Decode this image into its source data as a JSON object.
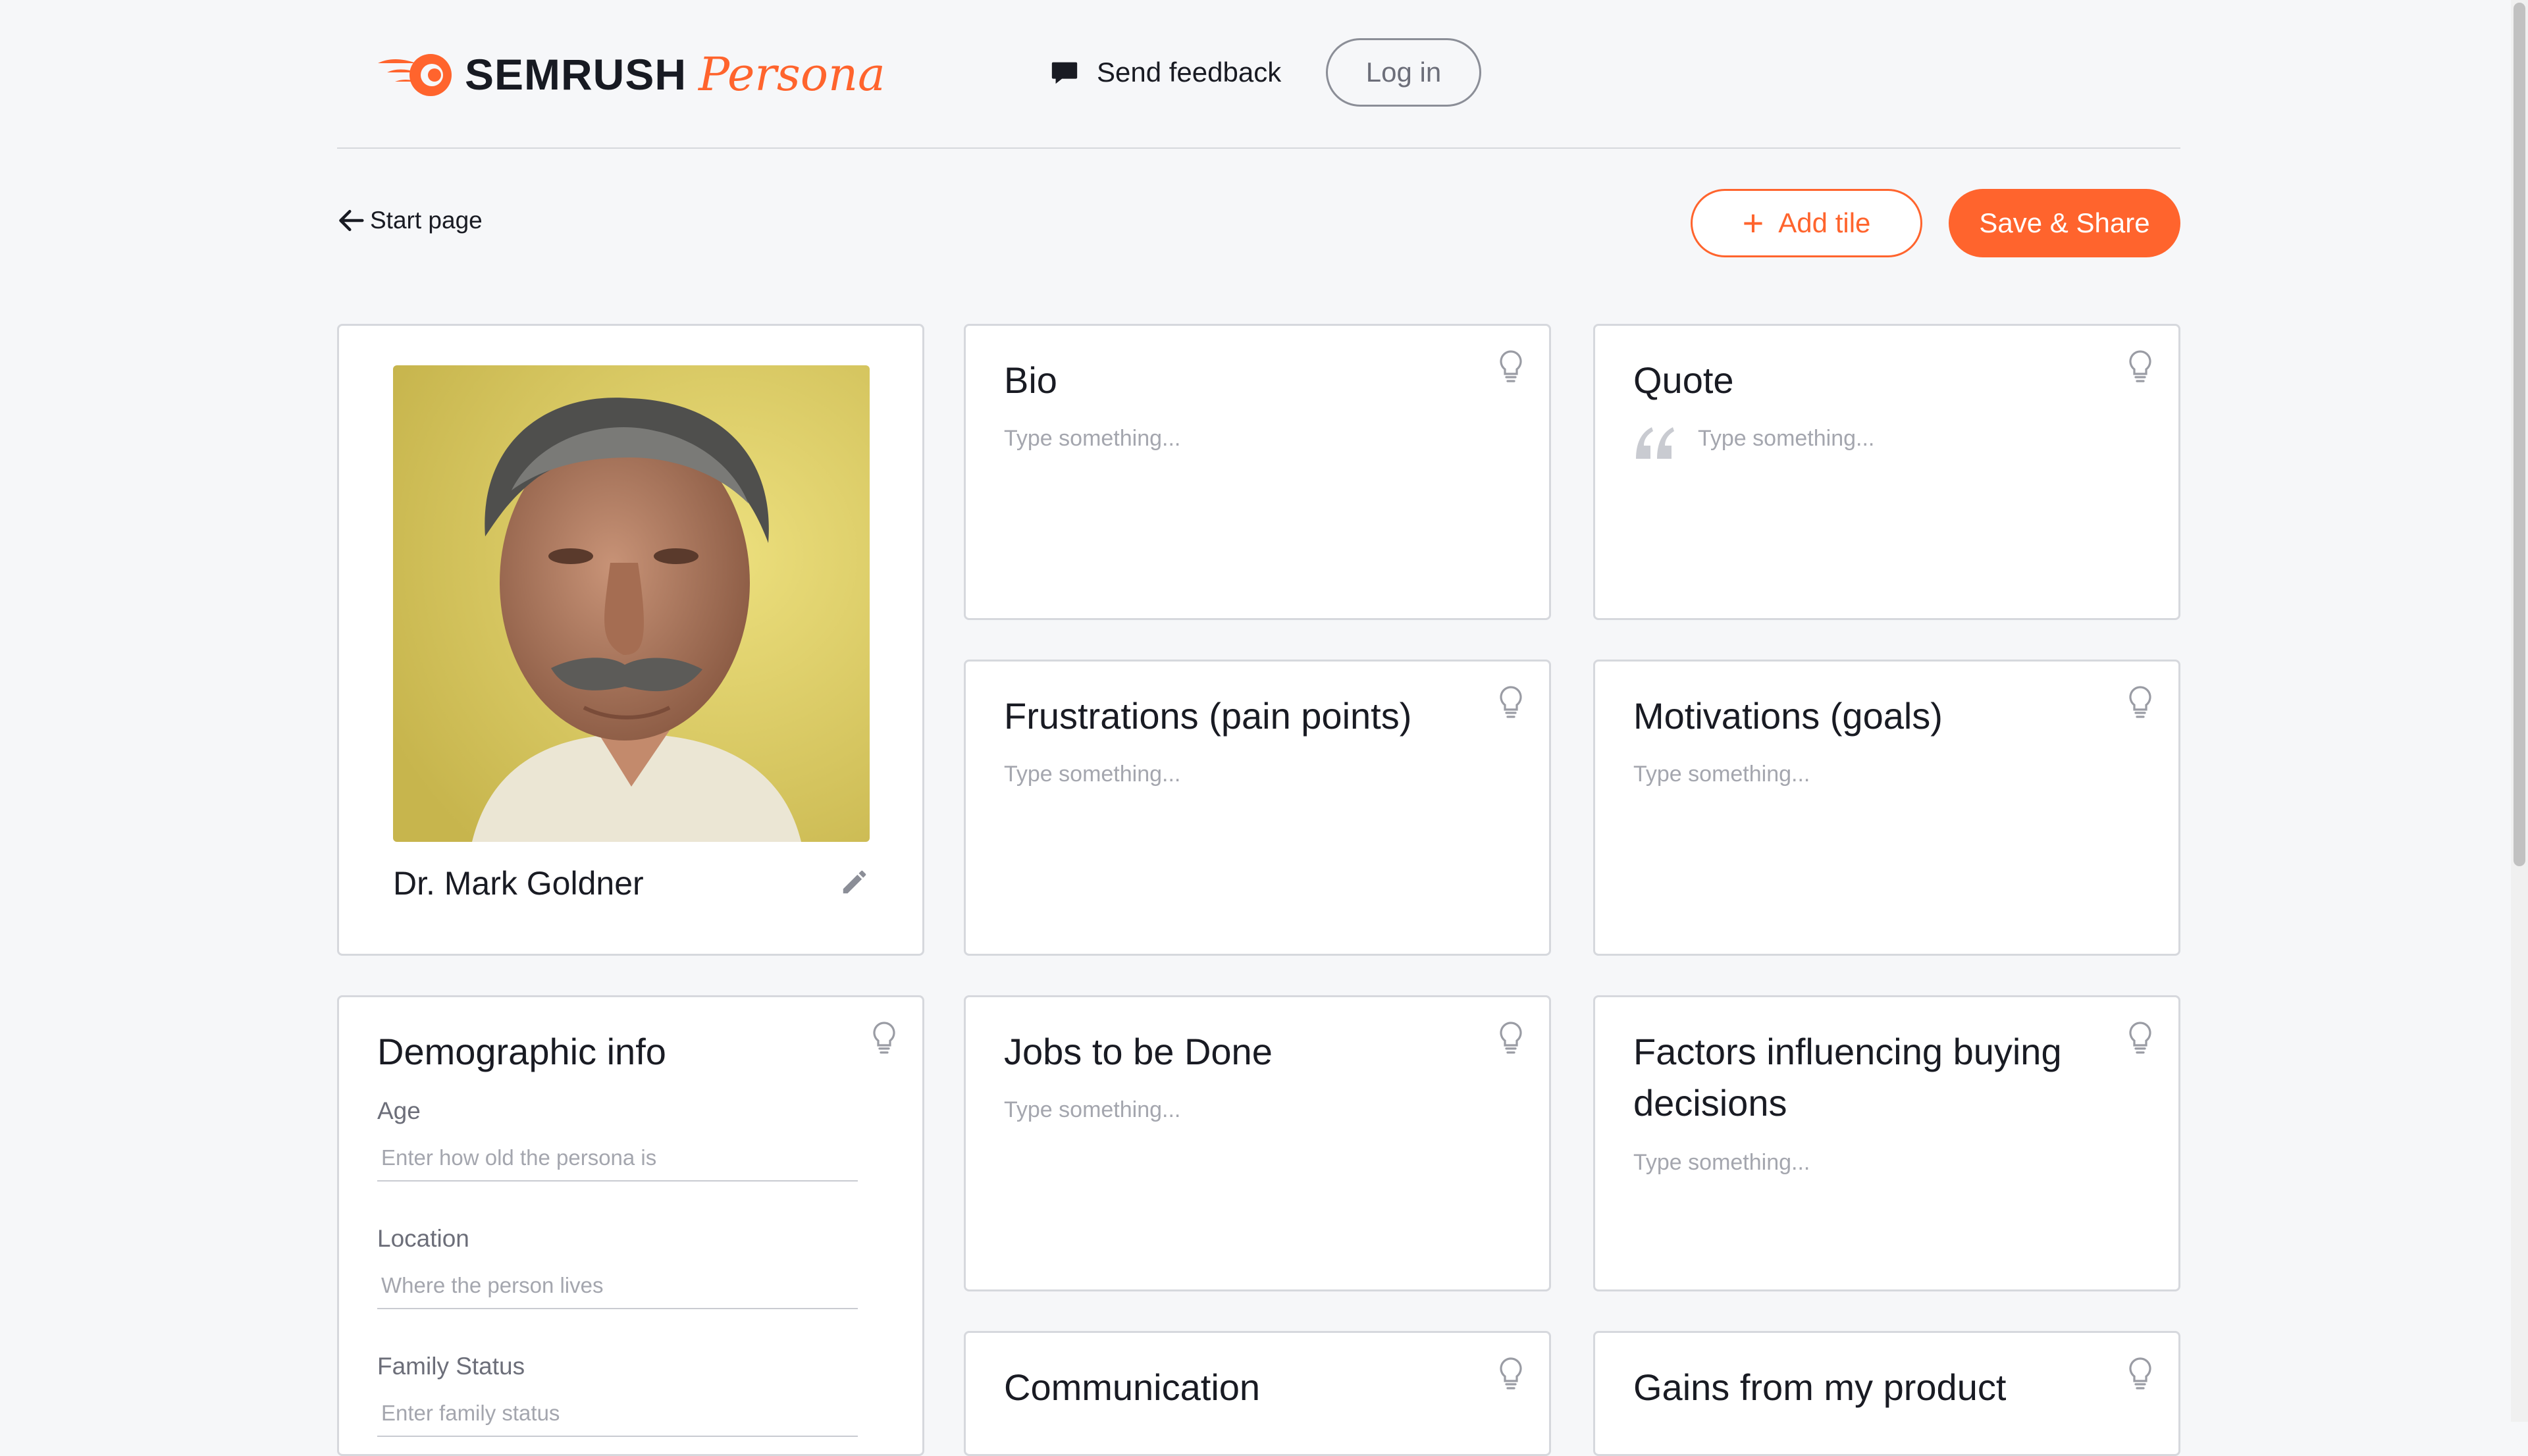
{
  "header": {
    "brand": "SEMRUSH",
    "product": "Persona",
    "feedback_label": "Send feedback",
    "login_label": "Log in"
  },
  "toolbar": {
    "back_label": "Start page",
    "add_tile_label": "Add tile",
    "save_label": "Save & Share"
  },
  "persona": {
    "name": "Dr. Mark Goldner"
  },
  "tiles": {
    "bio": {
      "title": "Bio",
      "placeholder": "Type something..."
    },
    "quote": {
      "title": "Quote",
      "placeholder": "Type something..."
    },
    "frustrations": {
      "title": "Frustrations (pain points)",
      "placeholder": "Type something..."
    },
    "motivations": {
      "title": "Motivations (goals)",
      "placeholder": "Type something..."
    },
    "jobs": {
      "title": "Jobs to be Done",
      "placeholder": "Type something..."
    },
    "factors": {
      "title": "Factors influencing buying decisions",
      "placeholder": "Type something..."
    },
    "communication": {
      "title": "Communication"
    },
    "gains": {
      "title": "Gains from my product"
    }
  },
  "demographic": {
    "title": "Demographic info",
    "age": {
      "label": "Age",
      "placeholder": "Enter how old the persona is"
    },
    "location": {
      "label": "Location",
      "placeholder": "Where the person lives"
    },
    "family": {
      "label": "Family Status",
      "placeholder": "Enter family status"
    }
  },
  "colors": {
    "accent": "#ff642d",
    "background": "#f6f7f9",
    "card_border": "#d6d8dd",
    "placeholder": "#a4a6ae"
  }
}
